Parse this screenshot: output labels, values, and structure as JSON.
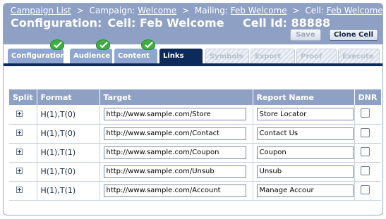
{
  "breadcrumb": {
    "campaign_list": "Campaign List",
    "sep": ">",
    "campaign_label": "Campaign:",
    "campaign_name": "Welcome",
    "mailing_label": "Mailing:",
    "mailing_name": "Feb Welcome",
    "cell_label": "Cell:",
    "cell_name": "Feb Welcome"
  },
  "header": {
    "config_label": "Configuration:",
    "config_cell": "Cell: Feb Welcome",
    "cell_id": "Cell Id: 88888"
  },
  "buttons": {
    "save": "Save",
    "clone_cell": "Clone Cell"
  },
  "tabs": [
    {
      "label": "Configuration",
      "state": "done"
    },
    {
      "label": "Audience",
      "state": "done"
    },
    {
      "label": "Content",
      "state": "done"
    },
    {
      "label": "Links",
      "state": "active"
    },
    {
      "label": "Symbols",
      "state": "todo"
    },
    {
      "label": "Export",
      "state": "todo"
    },
    {
      "label": "Proof",
      "state": "todo"
    },
    {
      "label": "Execute",
      "state": "todo"
    }
  ],
  "table": {
    "headers": {
      "split": "Split",
      "format": "Format",
      "target": "Target",
      "report_name": "Report Name",
      "dnr": "DNR"
    },
    "rows": [
      {
        "format": "H(1),T(0)",
        "target": "http://www.sample.com/Store",
        "report_name": "Store Locator",
        "dnr": false
      },
      {
        "format": "H(1),T(0)",
        "target": "http://www.sample.com/Contact",
        "report_name": "Contact Us",
        "dnr": false
      },
      {
        "format": "H(1),T(1)",
        "target": "http://www.sample.com/Coupon",
        "report_name": "Coupon",
        "dnr": false
      },
      {
        "format": "H(1),T(0)",
        "target": "http://www.sample.com/Unsub",
        "report_name": "Unsub",
        "dnr": false
      },
      {
        "format": "H(1),T(1)",
        "target": "http://www.sample.com/Account",
        "report_name": "Manage Accour",
        "dnr": false
      }
    ]
  },
  "colors": {
    "header_bg": "#8ea0c4",
    "active_tab": "#0c2a5a",
    "done_tab": "#8ea6d0",
    "check": "#3fae3f"
  }
}
